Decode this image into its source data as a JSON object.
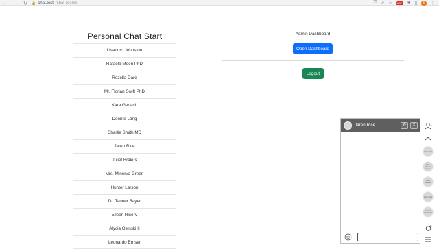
{
  "browser": {
    "url_host": "chat.test",
    "url_path": "/chat-rooms",
    "ext_badge": "ABP",
    "profile_initial": "S"
  },
  "left": {
    "title": "Personal Chat Start",
    "users": [
      "Lisandro Johnston",
      "Rafaela Moen PhD",
      "Rozella Dare",
      "Mr. Florian Swift PhD",
      "Kara Gerlach",
      "Deonte Lang",
      "Charlie Smith MD",
      "Jaren Rice",
      "Juliet Brakus",
      "Mrs. Minerva Green",
      "Hunter Larson",
      "Dr. Tanner Bayer",
      "Eileen Rice V",
      "Alycia Osinski II",
      "Leonardo Ernser"
    ]
  },
  "admin": {
    "title": "Admin Dashboard",
    "open_label": "Open Dashboard",
    "logout_label": "Logout"
  },
  "chat": {
    "name": "Jaren Rice",
    "undo_symbol": "↶",
    "close_symbol": "X",
    "input_value": "",
    "input_placeholder": ""
  },
  "sidebar": {
    "contacts": [
      "Jaren Rice",
      "Mrs. Minerva Green",
      "Juliet Brakus",
      "Jaren Rice",
      "Charlie Smith MD"
    ]
  },
  "colors": {
    "primary": "#0d6efd",
    "success": "#198754",
    "chat_header": "#5f5f5f"
  }
}
